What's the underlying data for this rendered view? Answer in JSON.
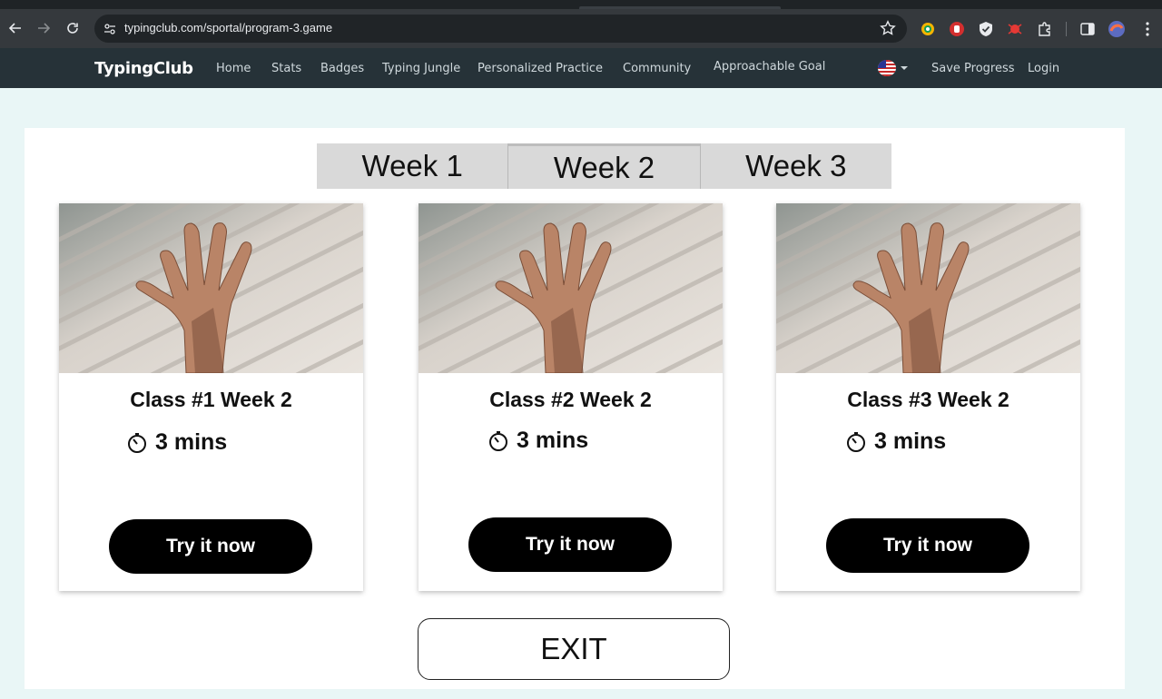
{
  "browser": {
    "url": "typingclub.com/sportal/program-3.game",
    "icons": [
      "back-icon",
      "forward-icon",
      "reload-icon",
      "site-info-icon",
      "star-icon",
      "extension-icons",
      "side-panel-icon",
      "profile-avatar",
      "menu-icon"
    ]
  },
  "site": {
    "brand": "TypingClub",
    "nav": [
      "Home",
      "Stats",
      "Badges",
      "Typing Jungle",
      "Personalized Practice",
      "Community",
      "Approachable Goal"
    ],
    "save_progress": "Save Progress",
    "login": "Login"
  },
  "weeks": {
    "tabs": [
      "Week 1",
      "Week 2",
      "Week 3"
    ],
    "active": "Week 2"
  },
  "cards": [
    {
      "title": "Class #1 Week 2",
      "duration": "3 mins",
      "button": "Try it now"
    },
    {
      "title": "Class #2 Week 2",
      "duration": "3 mins",
      "button": "Try it now"
    },
    {
      "title": "Class #3 Week 2",
      "duration": "3 mins",
      "button": "Try it now"
    }
  ],
  "exit_label": "EXIT",
  "colors": {
    "page_bg": "#e9f6f6",
    "nav_bg": "#263238",
    "tab_bg": "#d9d9d9",
    "button_bg": "#000000"
  }
}
